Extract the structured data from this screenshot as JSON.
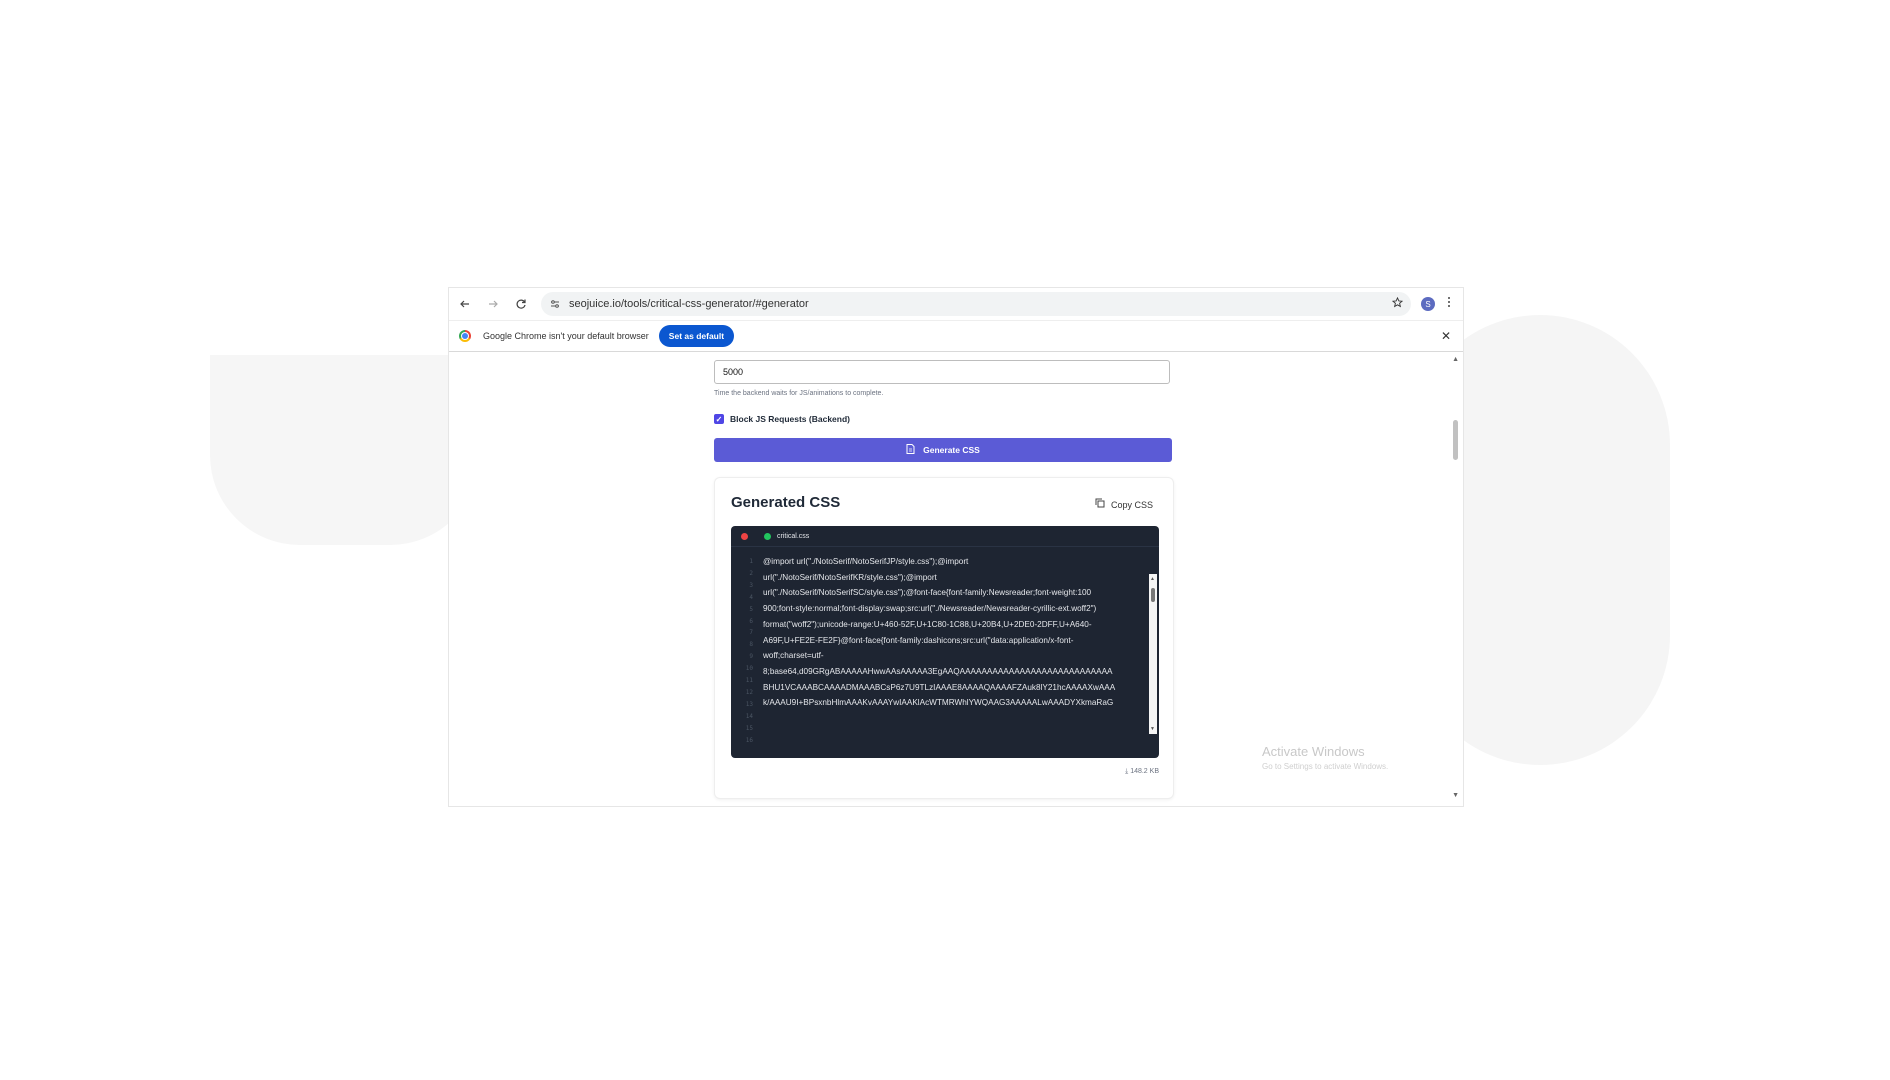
{
  "browser": {
    "url": "seojuice.io/tools/critical-css-generator/#generator",
    "profile_initial": "S"
  },
  "infobar": {
    "message": "Google Chrome isn't your default browser",
    "button": "Set as default"
  },
  "form": {
    "wait_value": "5000",
    "wait_help": "Time the backend waits for JS/animations to complete.",
    "block_js_label": "Block JS Requests (Backend)",
    "block_js_checked": true,
    "generate_label": "Generate CSS"
  },
  "output": {
    "title": "Generated CSS",
    "copy_label": "Copy CSS",
    "file_name": "critical.css",
    "line_numbers": "1\n2\n3\n4\n5\n6\n7\n8\n9\n10\n11\n12\n13\n14\n15\n16",
    "code": "@import url(\"./NotoSerif/NotoSerifJP/style.css\");@import\nurl(\"./NotoSerif/NotoSerifKR/style.css\");@import\nurl(\"./NotoSerif/NotoSerifSC/style.css\");@font-face{font-family:Newsreader;font-weight:100\n900;font-style:normal;font-display:swap;src:url(\"./Newsreader/Newsreader-cyrillic-ext.woff2\")\nformat(\"woff2\");unicode-range:U+460-52F,U+1C80-1C88,U+20B4,U+2DE0-2DFF,U+A640-\nA69F,U+FE2E-FE2F}@font-face{font-family:dashicons;src:url(\"data:application/x-font-\nwoff;charset=utf-\n8;base64,d09GRgABAAAAAHwwAAsAAAAA3EgAAQAAAAAAAAAAAAAAAAAAAAAAAAAAAA\nBHU1VCAAABCAAAADMAAABCsP6z7U9TLzIAAAE8AAAAQAAAAFZAuk8lY21hcAAAAXwAAA\nk/AAAU9I+BPsxnbHlmAAAKvAAAYwIAAKlAcWTMRWhlYWQAAG3AAAAALwAAADYXkmaRaG",
    "file_size": "148.2 KB"
  },
  "os_overlay": {
    "activate_title": "Activate Windows",
    "activate_sub": "Go to Settings to activate Windows."
  }
}
